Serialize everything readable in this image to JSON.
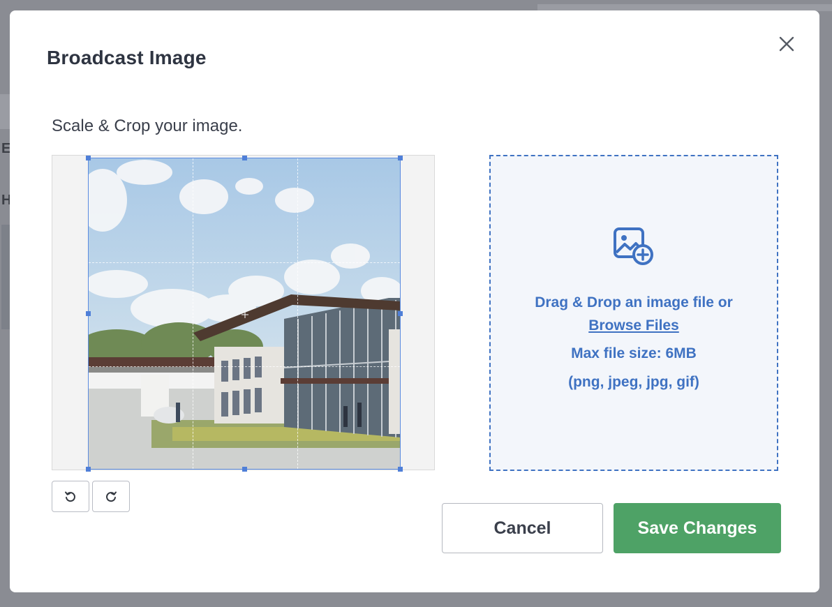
{
  "modal": {
    "title": "Broadcast Image",
    "instructions": "Scale & Crop your image."
  },
  "background": {
    "letter_1": "E",
    "letter_2": "H"
  },
  "icons": {
    "close": "close-icon",
    "rotate_left": "rotate-left-icon",
    "rotate_right": "rotate-right-icon",
    "upload": "image-add-icon"
  },
  "dropzone": {
    "drag_text": "Drag & Drop an image file",
    "or_text": "or",
    "browse_label": "Browse Files",
    "max_size": "Max file size: 6MB",
    "formats": "(png, jpeg, jpg, gif)"
  },
  "footer": {
    "cancel_label": "Cancel",
    "save_label": "Save Changes"
  },
  "colors": {
    "accent": "#3f72c2",
    "save": "#4ea266",
    "crop_border": "#5b8be0"
  }
}
